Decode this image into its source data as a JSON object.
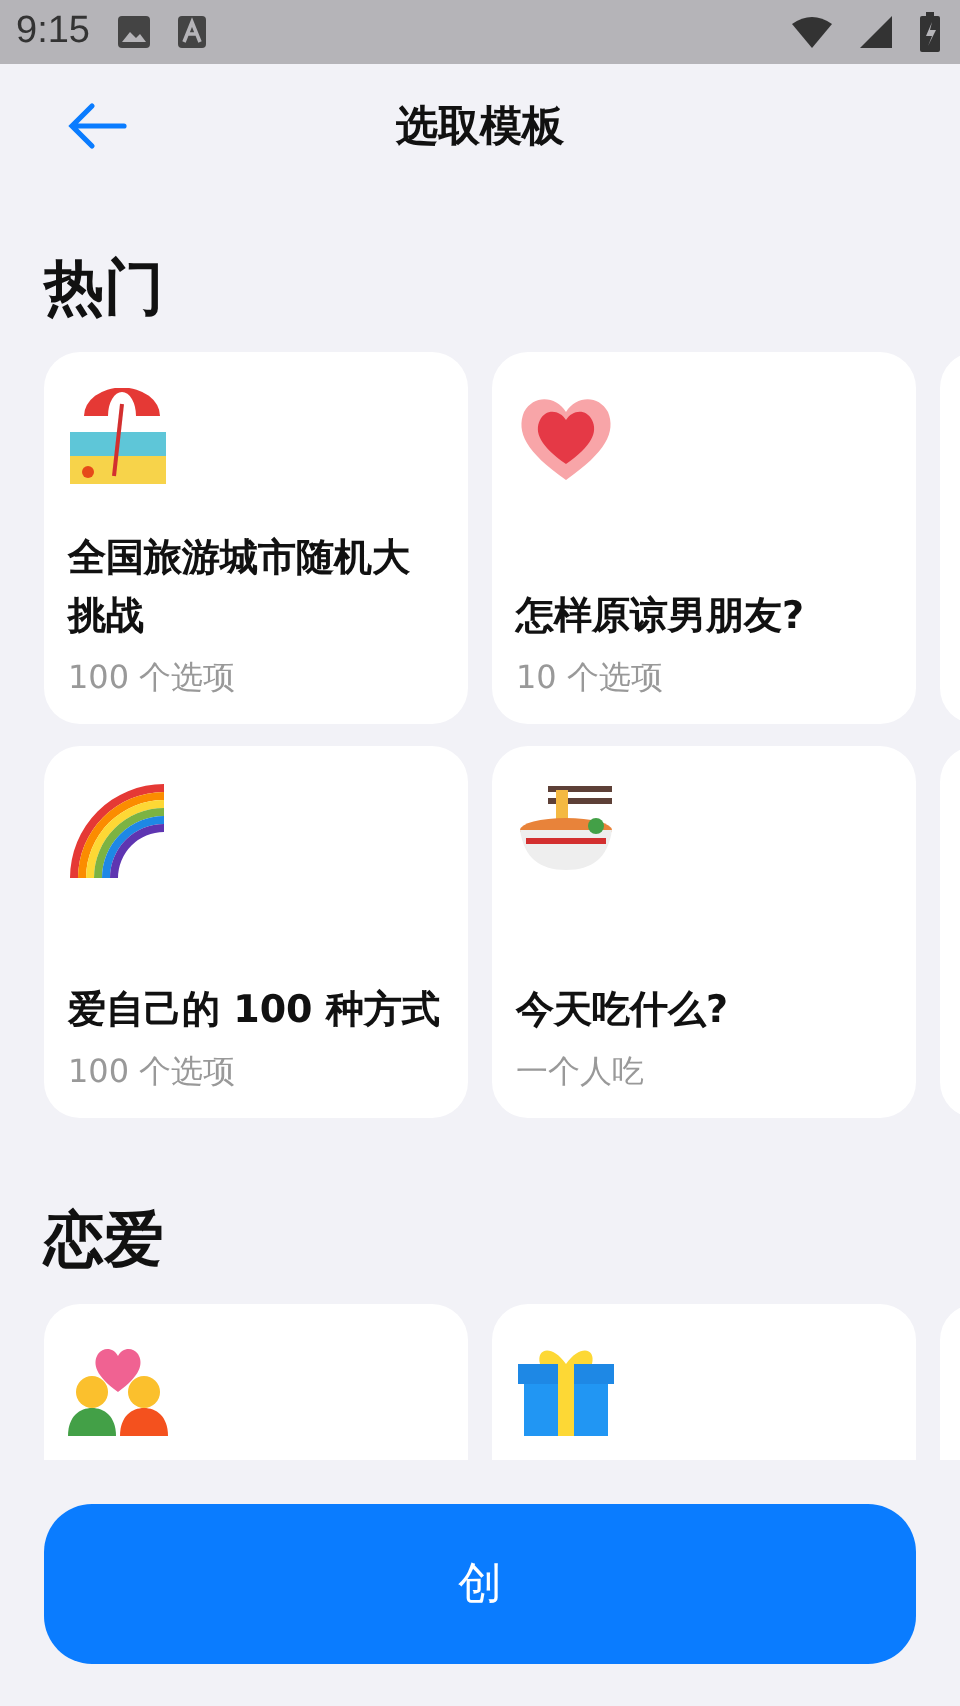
{
  "status_bar": {
    "time": "9:15"
  },
  "header": {
    "title": "选取模板"
  },
  "sections": [
    {
      "title": "热门",
      "rows": [
        [
          {
            "title": "全国旅游城市随机大挑战",
            "subtitle": "100 个选项"
          },
          {
            "title": "怎样原谅男朋友?",
            "subtitle": "10 个选项"
          }
        ],
        [
          {
            "title": "爱自己的 100 种方式",
            "subtitle": "100 个选项"
          },
          {
            "title": "今天吃什么?",
            "subtitle": "一个人吃"
          }
        ]
      ]
    },
    {
      "title": "恋爱",
      "rows": [
        [
          {},
          {}
        ]
      ]
    }
  ],
  "bottom_button": {
    "label": "创"
  }
}
